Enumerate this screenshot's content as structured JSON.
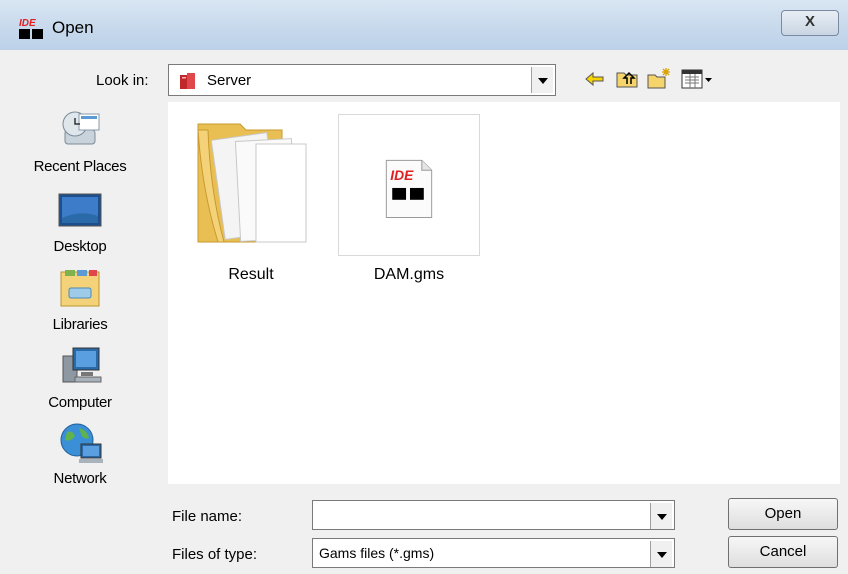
{
  "window": {
    "title": "Open",
    "app_icon_text": "IDE",
    "close_glyph": "X"
  },
  "lookin": {
    "label": "Look in:",
    "value": "Server",
    "toolbar": [
      {
        "name": "back-icon"
      },
      {
        "name": "up-folder-icon"
      },
      {
        "name": "new-folder-icon"
      },
      {
        "name": "view-menu-icon"
      }
    ]
  },
  "places": [
    {
      "label": "Recent Places",
      "icon": "recent-places-icon"
    },
    {
      "label": "Desktop",
      "icon": "desktop-icon"
    },
    {
      "label": "Libraries",
      "icon": "libraries-icon"
    },
    {
      "label": "Computer",
      "icon": "computer-icon"
    },
    {
      "label": "Network",
      "icon": "network-icon"
    }
  ],
  "files": [
    {
      "label": "Result",
      "icon": "folder-icon"
    },
    {
      "label": "DAM.gms",
      "icon": "gms-file-icon",
      "badge": "IDE"
    }
  ],
  "filename": {
    "label": "File name:",
    "value": "",
    "placeholder": ""
  },
  "filetype": {
    "label": "Files of type:",
    "value": "Gams files (*.gms)"
  },
  "buttons": {
    "open": "Open",
    "cancel": "Cancel"
  },
  "colors": {
    "titlebar": "#c6d8ec",
    "folder": "#f3d27a",
    "ide_red": "#e02020"
  }
}
